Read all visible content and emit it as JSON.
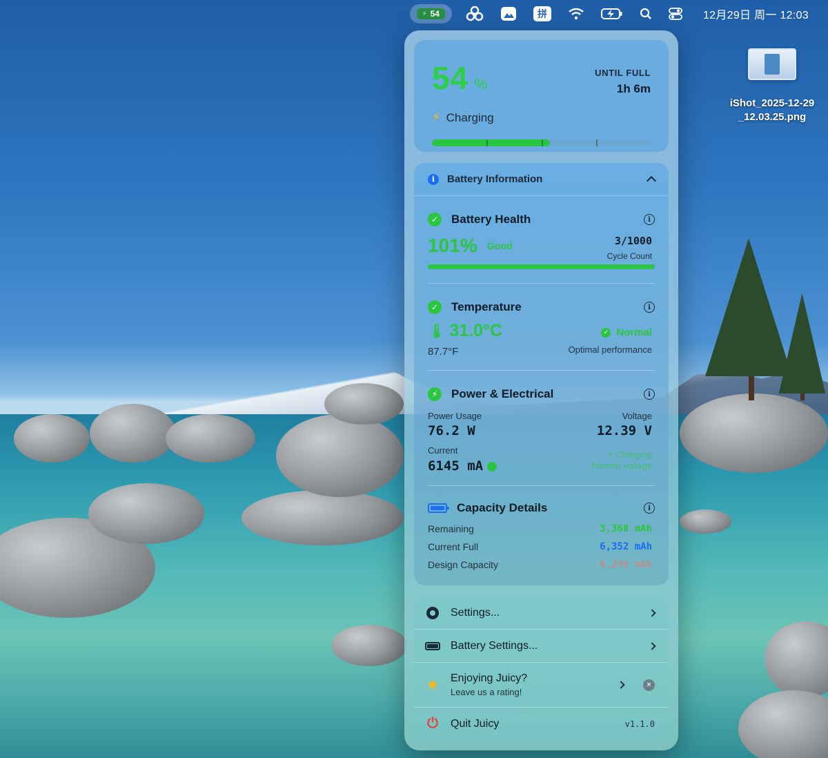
{
  "menubar": {
    "battery_percent": "54",
    "input_method": "拼",
    "clock": "12月29日 周一  12:03"
  },
  "desktop_file": {
    "name_line1": "iShot_2025-12-29",
    "name_line2": "_12.03.25.png"
  },
  "status": {
    "percent": "54",
    "percent_sign": "%",
    "until_label": "UNTIL FULL",
    "until_value": "1h 6m",
    "charging_label": "Charging",
    "charge_level": 0.54
  },
  "info": {
    "header": "Battery Information",
    "health": {
      "title": "Battery Health",
      "percent": "101%",
      "rating": "Good",
      "cycles": "3/1000",
      "cycles_label": "Cycle Count"
    },
    "temperature": {
      "title": "Temperature",
      "celsius": "31.0°C",
      "fahrenheit": "87.7°F",
      "status": "Normal",
      "note": "Optimal performance"
    },
    "power": {
      "title": "Power & Electrical",
      "usage_label": "Power Usage",
      "usage_value": "76.2 W",
      "voltage_label": "Voltage",
      "voltage_value": "12.39 V",
      "current_label": "Current",
      "current_value": "6145 mA",
      "charging_note": "Charging",
      "voltage_note": "Normal voltage"
    },
    "capacity": {
      "title": "Capacity Details",
      "remaining_label": "Remaining",
      "remaining_value": "3,368 mAh",
      "full_label": "Current Full",
      "full_value": "6,352 mAh",
      "design_label": "Design Capacity",
      "design_value": "6,249 mAh"
    }
  },
  "menu": {
    "settings": "Settings...",
    "battery_settings": "Battery Settings...",
    "rating_title": "Enjoying Juicy?",
    "rating_sub": "Leave us a rating!",
    "quit": "Quit Juicy",
    "version": "v1.1.0"
  },
  "colors": {
    "accent_green": "#2bc641",
    "accent_blue": "#1b6df2",
    "warning_yellow": "#f3b81a",
    "quit_red": "#e2403a"
  }
}
